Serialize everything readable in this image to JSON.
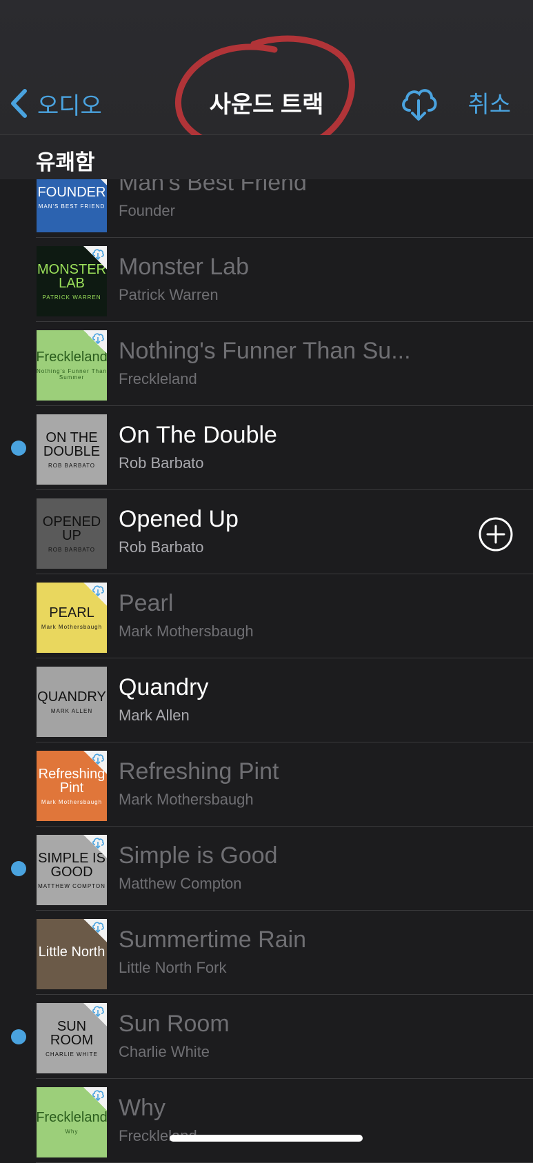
{
  "nav": {
    "back_label": "오디오",
    "title": "사운드 트랙",
    "cancel_label": "취소",
    "download_icon": "cloud-download-icon",
    "accent_color": "#4aa3df"
  },
  "section": {
    "title": "유쾌함"
  },
  "tracks": [
    {
      "title": "Man's Best Friend",
      "artist": "Founder",
      "state": "dim",
      "dot": false,
      "art_text": "FOUNDER",
      "art_sub": "MAN'S BEST FRIEND"
    },
    {
      "title": "Monster Lab",
      "artist": "Patrick Warren",
      "state": "dim",
      "dot": false,
      "art_text": "MONSTER LAB",
      "art_sub": "PATRICK WARREN"
    },
    {
      "title": "Nothing's Funner Than Su...",
      "artist": "Freckleland",
      "state": "dim",
      "dot": false,
      "art_text": "Freckleland",
      "art_sub": "Nothing's Funner Than Summer"
    },
    {
      "title": "On The Double",
      "artist": "Rob Barbato",
      "state": "active",
      "dot": true,
      "art_text": "ON THE DOUBLE",
      "art_sub": "ROB BARBATO"
    },
    {
      "title": "Opened Up",
      "artist": "Rob Barbato",
      "state": "active",
      "dot": false,
      "art_text": "OPENED UP",
      "art_sub": "ROB BARBATO",
      "add": true
    },
    {
      "title": "Pearl",
      "artist": "Mark Mothersbaugh",
      "state": "dim",
      "dot": false,
      "art_text": "PEARL",
      "art_sub": "Mark Mothersbaugh"
    },
    {
      "title": "Quandry",
      "artist": "Mark Allen",
      "state": "active",
      "dot": false,
      "art_text": "QUANDRY",
      "art_sub": "MARK ALLEN"
    },
    {
      "title": "Refreshing Pint",
      "artist": "Mark Mothersbaugh",
      "state": "dim",
      "dot": false,
      "art_text": "Refreshing Pint",
      "art_sub": "Mark Mothersbaugh"
    },
    {
      "title": "Simple is Good",
      "artist": "Matthew Compton",
      "state": "dim",
      "dot": true,
      "art_text": "SIMPLE IS GOOD",
      "art_sub": "MATTHEW COMPTON"
    },
    {
      "title": "Summertime Rain",
      "artist": "Little North Fork",
      "state": "dim",
      "dot": false,
      "art_text": "Little North",
      "art_sub": ""
    },
    {
      "title": "Sun Room",
      "artist": "Charlie White",
      "state": "dim",
      "dot": true,
      "art_text": "SUN ROOM",
      "art_sub": "CHARLIE WHITE"
    },
    {
      "title": "Why",
      "artist": "Freckleland",
      "state": "dim",
      "dot": false,
      "art_text": "Freckleland",
      "art_sub": "Why"
    }
  ]
}
